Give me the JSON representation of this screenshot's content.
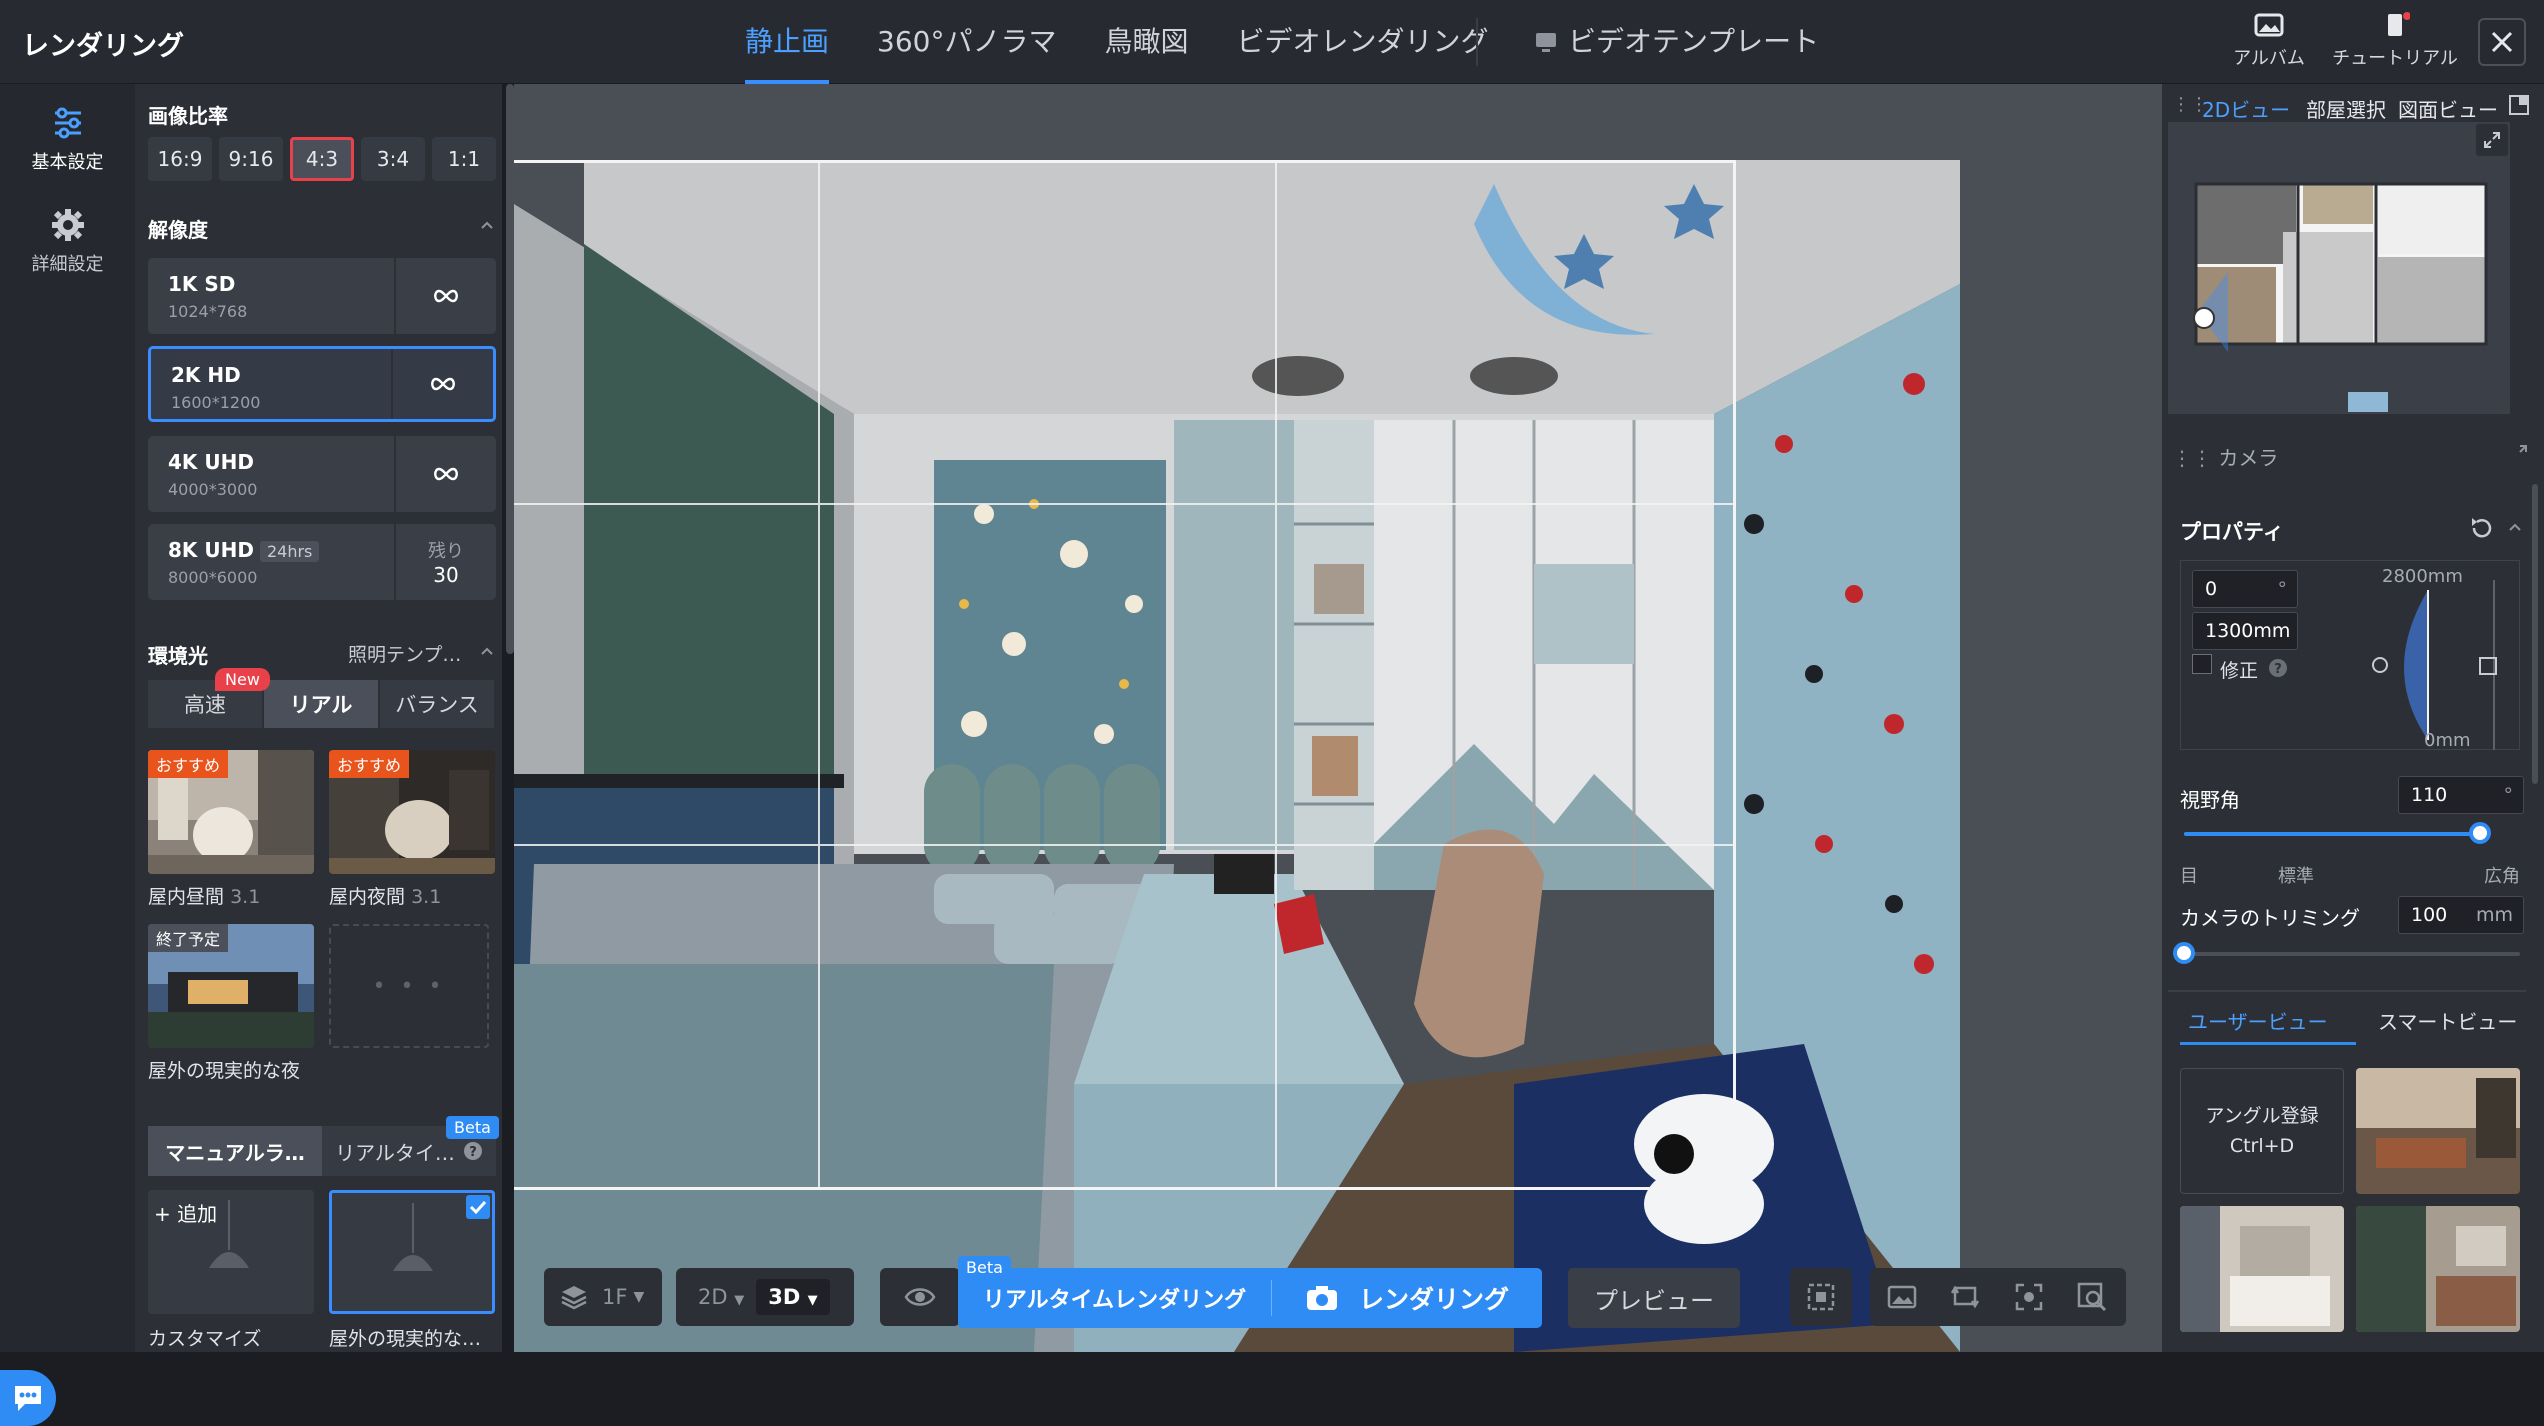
{
  "header": {
    "title": "レンダリング",
    "tabs": [
      {
        "label": "静止画",
        "active": true
      },
      {
        "label": "360°パノラマ"
      },
      {
        "label": "鳥瞰図"
      },
      {
        "label": "ビデオレンダリング"
      }
    ],
    "template_tab": "ビデオテンプレート",
    "album": "アルバム",
    "tutorial": "チュートリアル"
  },
  "leftnav": {
    "basic": "基本設定",
    "advanced": "詳細設定"
  },
  "settings": {
    "ratio_title": "画像比率",
    "ratios": [
      "16:9",
      "9:16",
      "4:3",
      "3:4",
      "1:1"
    ],
    "selected_ratio": "4:3",
    "resolution_title": "解像度",
    "resolutions": [
      {
        "name": "1K SD",
        "size": "1024*768"
      },
      {
        "name": "2K HD",
        "size": "1600*1200",
        "selected": true
      },
      {
        "name": "4K UHD",
        "size": "4000*3000"
      },
      {
        "name": "8K UHD",
        "badge": "24hrs",
        "size": "8000*6000",
        "remaining_label": "残り",
        "remaining": "30"
      }
    ],
    "env_title": "環境光",
    "lighting_template": "照明テンプ…",
    "modes": [
      "高速",
      "リアル",
      "バランス"
    ],
    "new_badge": "New",
    "presets": [
      {
        "ribbon": "おすすめ",
        "name": "屋内昼間",
        "version": "3.1"
      },
      {
        "ribbon": "おすすめ",
        "name": "屋内夜間",
        "version": "3.1"
      },
      {
        "ribbon": "終了予定",
        "name": "屋外の現実的な夜"
      }
    ],
    "empty_card": "• • •",
    "light_modes": [
      "マニュアルラ…",
      "リアルタイ…"
    ],
    "beta": "Beta",
    "add_label": "+ 追加",
    "lamp_caps": [
      "カスタマイズ",
      "屋外の現実的な…"
    ]
  },
  "bottombar": {
    "floor": "1F",
    "view2d": "2D",
    "view3d": "3D",
    "realtime": "リアルタイムレンダリング",
    "render": "レンダリング",
    "beta": "Beta",
    "preview": "プレビュー"
  },
  "right": {
    "tabs": [
      "2Dビュー",
      "部屋選択",
      "図面ビュー"
    ],
    "camera_title": "カメラ",
    "properties": "プロパティ",
    "angle_value": "0",
    "angle_unit": "°",
    "height_value": "1300mm",
    "correction": "修正",
    "top_mm": "2800mm",
    "bottom_mm": "0mm",
    "fov_label": "視野角",
    "fov_value": "110",
    "fov_unit": "°",
    "fov_percent": 100,
    "fov_ticks": [
      "目",
      "標準",
      "広角"
    ],
    "trim_label": "カメラのトリミング",
    "trim_value": "100",
    "trim_unit": "mm",
    "trim_percent": 0,
    "view_tabs": [
      "ユーザービュー",
      "スマートビュー"
    ],
    "angle_card": [
      "アングル登録",
      "Ctrl+D"
    ]
  },
  "colors": {
    "accent": "#2f8cf5",
    "selected_ratio_border": "#e8414a",
    "ribbon": "#e8541c"
  }
}
